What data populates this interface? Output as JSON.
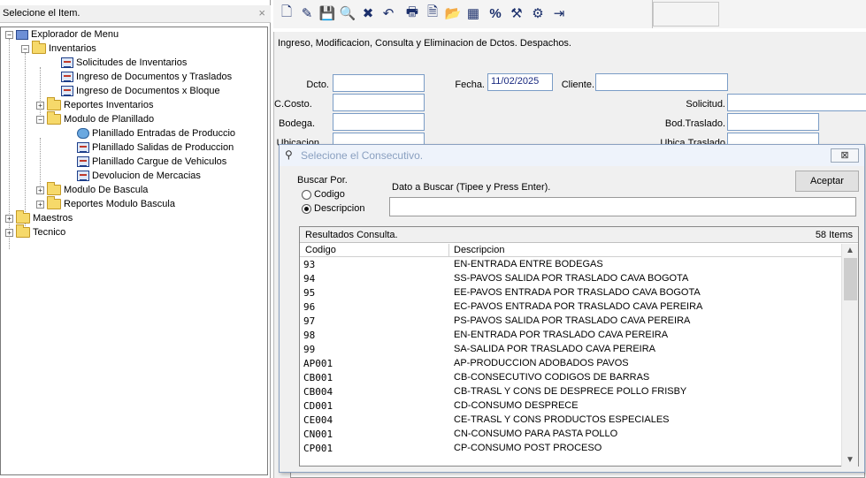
{
  "left_panel": {
    "title": "Selecione el Item.",
    "close": "×"
  },
  "tree": [
    {
      "label": "Explorador de Menu",
      "icon": "computer-icon",
      "expander": "−"
    },
    {
      "label": "Inventarios",
      "icon": "folder-open-icon",
      "expander": "−"
    },
    {
      "label": "Solicitudes de Inventarios",
      "icon": "form-icon"
    },
    {
      "label": "Ingreso de Documentos  y Traslados",
      "icon": "form-icon"
    },
    {
      "label": "Ingreso de Documentos x Bloque",
      "icon": "form-icon"
    },
    {
      "label": "Reportes Inventarios",
      "icon": "folder-icon",
      "expander": "+"
    },
    {
      "label": "Modulo de Planillado",
      "icon": "folder-open-icon",
      "expander": "−"
    },
    {
      "label": "Planillado Entradas de Produccio",
      "icon": "globe-icon"
    },
    {
      "label": "Planillado Salidas de Produccion",
      "icon": "form-icon"
    },
    {
      "label": "Planillado Cargue de Vehiculos",
      "icon": "form-icon"
    },
    {
      "label": "Devolucion de Mercacias",
      "icon": "form-icon"
    },
    {
      "label": "Modulo De Bascula",
      "icon": "folder-icon",
      "expander": "+"
    },
    {
      "label": "Reportes Modulo Bascula",
      "icon": "folder-icon",
      "expander": "+"
    },
    {
      "label": "Maestros",
      "icon": "folder-icon",
      "expander": "+"
    },
    {
      "label": "Tecnico",
      "icon": "folder-icon",
      "expander": "+"
    }
  ],
  "toolbar": {
    "buttons": [
      {
        "name": "new-document-icon",
        "glyph": "🗋"
      },
      {
        "name": "edit-icon",
        "glyph": "✎"
      },
      {
        "name": "save-icon",
        "glyph": "💾"
      },
      {
        "name": "find-icon",
        "glyph": "🔍"
      },
      {
        "name": "delete-icon",
        "glyph": "✖"
      },
      {
        "name": "undo-icon",
        "glyph": "↶"
      },
      {
        "name": "print-icon",
        "glyph": "🖶"
      },
      {
        "name": "print-preview-icon",
        "glyph": "🗎"
      },
      {
        "name": "open-folder-icon",
        "glyph": "📂"
      },
      {
        "name": "calculator-icon",
        "glyph": "▦"
      },
      {
        "name": "percent-icon",
        "glyph": "%"
      },
      {
        "name": "tools-icon",
        "glyph": "⚒"
      },
      {
        "name": "settings-icon",
        "glyph": "⚙"
      },
      {
        "name": "exit-icon",
        "glyph": "⇥"
      }
    ]
  },
  "form": {
    "title": "Ingreso, Modificacion, Consulta y Eliminacion de Dctos. Despachos.",
    "dcto_label": "Dcto.",
    "ccosto_label": "C.Costo.",
    "bodega_label": "Bodega.",
    "ubicacion_label": "Ubicacion.",
    "fecha_label": "Fecha.",
    "fecha_value": "11/02/2025",
    "cliente_label": "Cliente.",
    "solicitud_label": "Solicitud.",
    "bod_traslado_label": "Bod.Traslado.",
    "ubica_traslado_label": "Ubica.Traslado"
  },
  "modal": {
    "title": "Selecione el Consecutivo.",
    "close": "⊠",
    "buscar_por": "Buscar Por.",
    "radio_codigo": "Codigo",
    "radio_descripcion": "Descripcion",
    "selected_radio": "Descripcion",
    "dato_label": "Dato a  Buscar (Tipee y Press Enter).",
    "search_value": "",
    "accept_button": "Aceptar",
    "results_title": "Resultados Consulta.",
    "results_count": "58 Items",
    "col_codigo": "Codigo",
    "col_descripcion": "Descripcion",
    "rows": [
      {
        "code": "93",
        "desc": "EN-ENTRADA ENTRE BODEGAS"
      },
      {
        "code": "94",
        "desc": "SS-PAVOS SALIDA POR TRASLADO CAVA BOGOTA"
      },
      {
        "code": "95",
        "desc": "EE-PAVOS ENTRADA  POR TRASLADO CAVA BOGOTA"
      },
      {
        "code": "96",
        "desc": "EC-PAVOS ENTRADA  POR TRASLADO CAVA PEREIRA"
      },
      {
        "code": "97",
        "desc": "PS-PAVOS SALIDA POR TRASLADO CAVA PEREIRA"
      },
      {
        "code": "98",
        "desc": "EN-ENTRADA POR TRASLADO CAVA PEREIRA"
      },
      {
        "code": "99",
        "desc": "SA-SALIDA POR TRASLADO CAVA PEREIRA"
      },
      {
        "code": "AP001",
        "desc": "AP-PRODUCCION ADOBADOS PAVOS"
      },
      {
        "code": "CB001",
        "desc": "CB-CONSECUTIVO CODIGOS DE BARRAS"
      },
      {
        "code": "CB004",
        "desc": "CB-TRASL Y CONS DE DESPRECE POLLO FRISBY"
      },
      {
        "code": "CD001",
        "desc": "CD-CONSUMO DESPRECE"
      },
      {
        "code": "CE004",
        "desc": "CE-TRASL Y CONS PRODUCTOS ESPECIALES"
      },
      {
        "code": "CN001",
        "desc": "CN-CONSUMO PARA PASTA POLLO"
      },
      {
        "code": "CP001",
        "desc": "CP-CONSUMO POST PROCESO"
      }
    ]
  }
}
